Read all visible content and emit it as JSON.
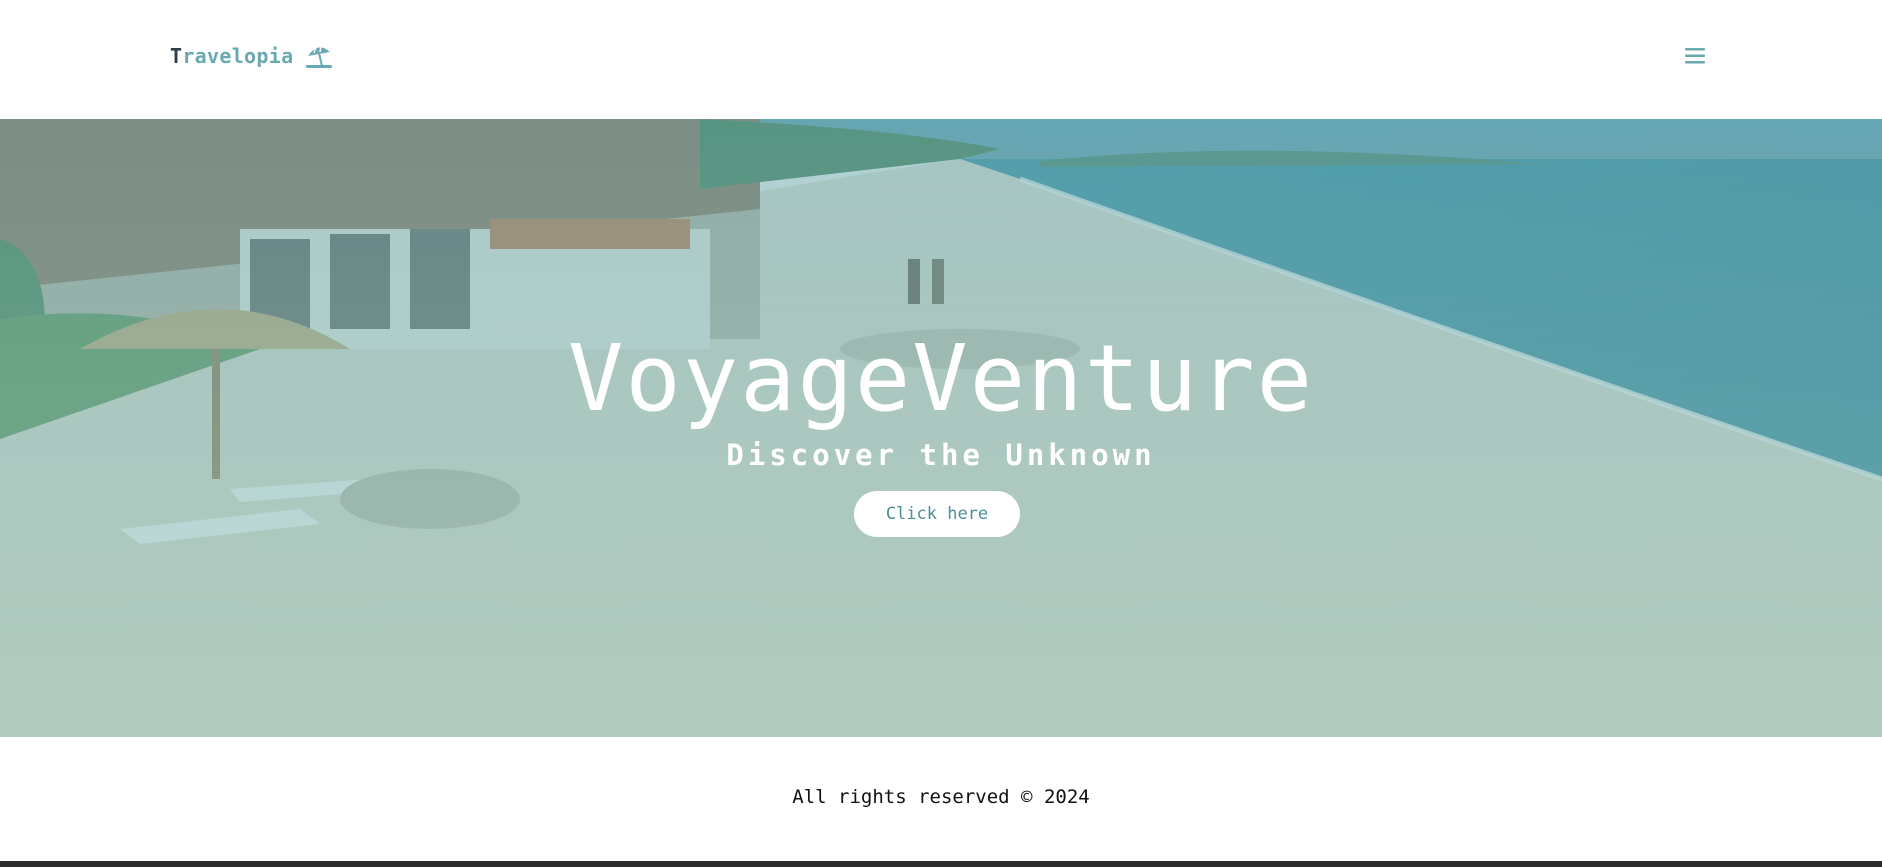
{
  "header": {
    "logo_first_letter": "T",
    "logo_rest": "ravelopia",
    "logo_icon": "beach-umbrella-icon",
    "menu_icon": "hamburger-menu-icon"
  },
  "hero": {
    "title": "VoyageVenture",
    "subtitle": "Discover the Unknown",
    "cta_label": "Click here"
  },
  "footer": {
    "text": "All rights reserved © 2024"
  },
  "colors": {
    "accent": "#6aa9b0",
    "logo_dark": "#2f3e46",
    "overlay": "#8fc0bb",
    "button_text": "#4d8f98"
  }
}
